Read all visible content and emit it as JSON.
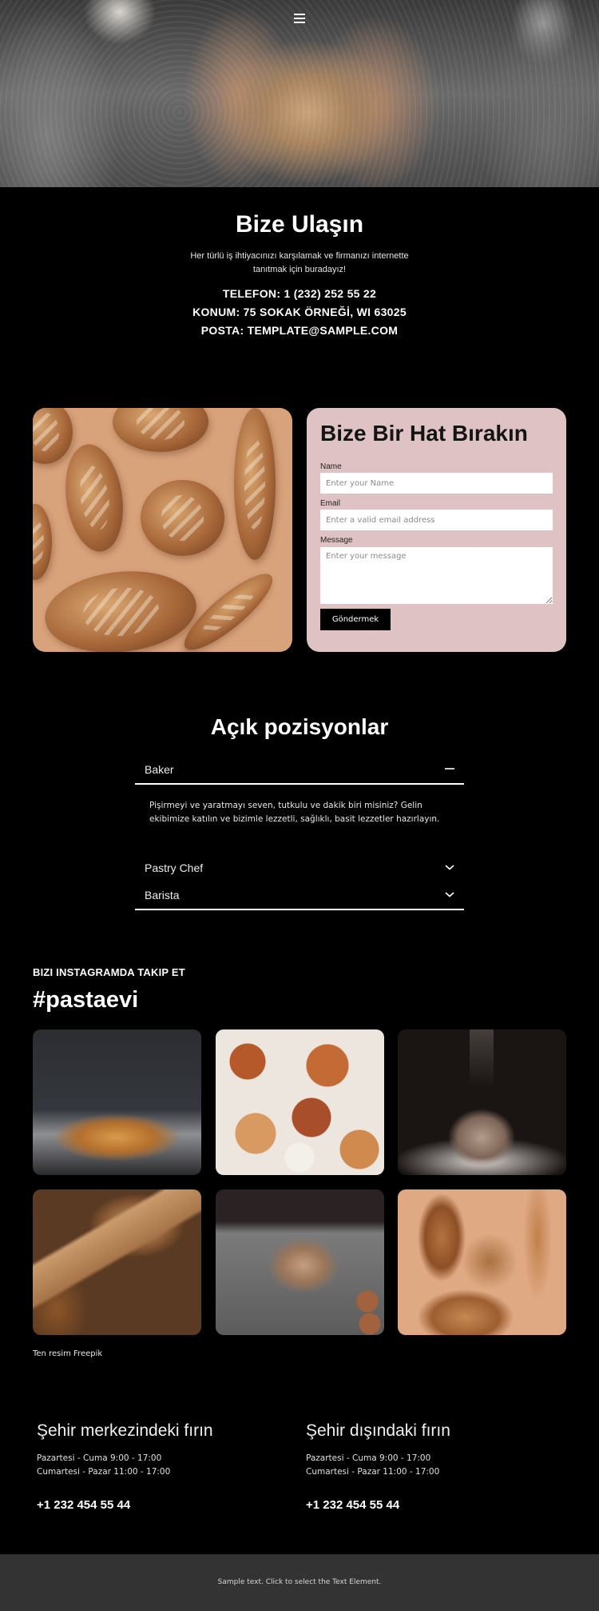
{
  "header": {
    "menu_icon": "hamburger-menu-icon",
    "hero_image": "hands-kneading-dough-photo"
  },
  "contact": {
    "title": "Bize Ulaşın",
    "lead": "Her türlü iş ihtiyacınızı karşılamak ve firmanızı internette tanıtmak için buradayız!",
    "phone": "TELEFON: 1 (232) 252 55 22",
    "location": "KONUM: 75 SOKAK ÖRNEĞİ, WI 63025",
    "email": "POSTA: TEMPLATE@SAMPLE.COM"
  },
  "form": {
    "title": "Bize Bir Hat Bırakın",
    "name_label": "Name",
    "name_placeholder": "Enter your Name",
    "email_label": "Email",
    "email_placeholder": "Enter a valid email address",
    "message_label": "Message",
    "message_placeholder": "Enter your message",
    "submit_label": "Göndermek",
    "card_color": "#dfc3c4"
  },
  "positions": {
    "title": "Açık pozisyonlar",
    "items": [
      {
        "label": "Baker",
        "state": "expanded",
        "icon": "minus-icon",
        "body": "Pişirmeyi ve yaratmayı seven, tutkulu ve dakik biri misiniz? Gelin ekibimize katılın ve bizimle lezzetli, sağlıklı, basit lezzetler hazırlayın."
      },
      {
        "label": "Pastry Chef",
        "state": "collapsed",
        "icon": "chevron-down-icon"
      },
      {
        "label": "Barista",
        "state": "collapsed",
        "icon": "chevron-down-icon"
      }
    ]
  },
  "instagram": {
    "kicker": "BIZI INSTAGRAMDA TAKIP ET",
    "hashtag": "#pastaevi",
    "tiles": [
      "croissants-on-tray-photo",
      "assorted-pastries-photo",
      "flour-falling-on-dough-photo",
      "rustic-bread-and-wheat-photo",
      "kneading-dough-photo",
      "bread-loaves-on-peach-photo"
    ],
    "credit": "Ten resim Freepik"
  },
  "bakeries": [
    {
      "title": "Şehir merkezindeki fırın",
      "hours_1": "Pazartesi - Cuma 9:00 - 17:00",
      "hours_2": "Cumartesi - Pazar 11:00 - 17:00",
      "phone": "+1 232 454 55 44"
    },
    {
      "title": "Şehir dışındaki fırın",
      "hours_1": "Pazartesi - Cuma 9:00 - 17:00",
      "hours_2": "Cumartesi - Pazar 11:00 - 17:00",
      "phone": "+1 232 454 55 44"
    }
  ],
  "footer": {
    "text": "Sample text. Click to select the Text Element."
  }
}
